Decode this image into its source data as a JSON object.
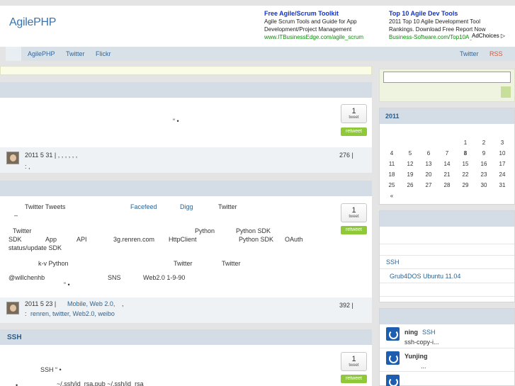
{
  "header": {
    "logo": "AgilePHP",
    "ads": [
      {
        "title": "Free Agile/Scrum Toolkit",
        "line1": "Agile Scrum Tools and Guide for App",
        "line2": "Development/Project Management",
        "url": "www.ITBusinessEdge.com/agile_scrum"
      },
      {
        "title": "Top 10 Agile Dev Tools",
        "line1": "2011 Top 10 Agile Development Tool",
        "line2": "Rankings. Download Free Report Now",
        "url": "Business-Software.com/Top10Agile"
      }
    ],
    "adchoices": "AdChoices ▷"
  },
  "nav": {
    "items": [
      "AgilePHP",
      "Twitter",
      "Flickr"
    ],
    "right": [
      "Twitter",
      "RSS"
    ]
  },
  "posts": [
    {
      "title": "",
      "body": [
        "“ •"
      ],
      "tweets": "1",
      "tweet_label": "tweet",
      "retweet": "retweet",
      "meta": "2011 5 31 |    ,   ,   ,   ,   ,   ,",
      "tags": " :  ,",
      "views": "276   |"
    },
    {
      "title": "",
      "line1": {
        "a": "Twitter  Tweets",
        "b": "Facefeed",
        "c": "Digg",
        "d": "Twitter"
      },
      "line1b": "–",
      "line2": {
        "a": "Twitter",
        "b": "Python",
        "c": "Python SDK"
      },
      "line3": {
        "a": "SDK",
        "b": "App",
        "c": "API",
        "d": "3g.renren.com",
        "e": "HttpClient",
        "f": "Python SDK",
        "g": "OAuth"
      },
      "line4": "status/update   SDK",
      "line5": {
        "a": "k-v  Python",
        "b": "Twitter",
        "c": "Twitter"
      },
      "line6": {
        "a": "@willchenhb",
        "b": "SNS",
        "c": "Web2.0   1-9-90"
      },
      "line7": "“ •",
      "tweets": "1",
      "tweet_label": "tweet",
      "retweet": "retweet",
      "meta_prefix": "2011 5 23 |",
      "meta_links": "Mobile, Web 2.0,",
      "meta_suffix": ",",
      "tags_prefix": " : ",
      "tags": "renren, twitter, Web2.0, weibo",
      "views": "392   |"
    },
    {
      "title": "SSH",
      "body": [
        "SSH     “ •"
      ],
      "bullet": "~/.ssh/id_rsa.pub      ~/.ssh/id_rsa",
      "tweets": "1",
      "tweet_label": "tweet",
      "retweet": "retweet"
    }
  ],
  "sidebar": {
    "calendar": {
      "title": "2011",
      "rows": [
        [
          "",
          "",
          "",
          "",
          "1",
          "2",
          "3"
        ],
        [
          "4",
          "5",
          "6",
          "7",
          "8",
          "9",
          "10"
        ],
        [
          "11",
          "12",
          "13",
          "14",
          "15",
          "16",
          "17"
        ],
        [
          "18",
          "19",
          "20",
          "21",
          "22",
          "23",
          "24"
        ],
        [
          "25",
          "26",
          "27",
          "28",
          "29",
          "30",
          "31"
        ]
      ],
      "bold_day": "8",
      "prev": "«"
    },
    "recent": {
      "items": [
        "SSH",
        "Grub4DOS  Ubuntu 11.04"
      ]
    },
    "comments": [
      {
        "name": "ning",
        "link": "SSH",
        "text": "ssh-copy-i..."
      },
      {
        "name": "Yunjing",
        "text": "..."
      },
      {
        "name": "",
        "text": ""
      }
    ]
  }
}
